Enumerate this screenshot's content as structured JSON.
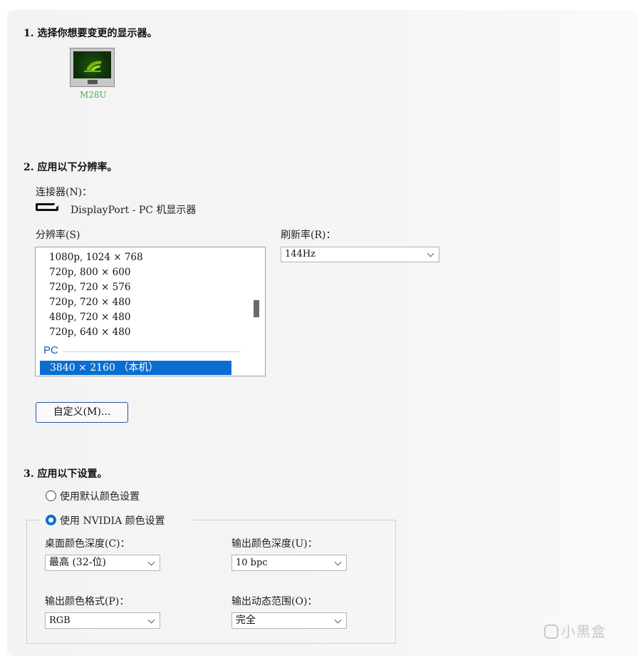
{
  "step1": {
    "title": "1. 选择你想要变更的显示器。",
    "monitor_name": "M28U"
  },
  "step2": {
    "title": "2. 应用以下分辨率。",
    "connector_label": "连接器(N)：",
    "connector_value": "DisplayPort - PC 机显示器",
    "resolution_label": "分辨率(S)",
    "refresh_label": "刷新率(R)：",
    "refresh_value": "144Hz",
    "resolutions": [
      "1080p, 1024 × 768",
      "720p, 800 × 600",
      "720p, 720 × 576",
      "720p, 720 × 480",
      "480p, 720 × 480",
      "720p, 640 × 480"
    ],
    "group_pc": "PC",
    "selected_resolution": "3840 × 2160 （本机）",
    "custom_button": "自定义(M)..."
  },
  "step3": {
    "title": "3. 应用以下设置。",
    "radio_default": "使用默认颜色设置",
    "radio_nvidia": "使用 NVIDIA 颜色设置",
    "desktop_depth_label": "桌面颜色深度(C)：",
    "desktop_depth_value": "最高 (32-位)",
    "output_depth_label": "输出颜色深度(U)：",
    "output_depth_value": "10 bpc",
    "output_format_label": "输出颜色格式(P)：",
    "output_format_value": "RGB",
    "dynamic_range_label": "输出动态范围(O)：",
    "dynamic_range_value": "完全"
  },
  "watermark": "小黑盒"
}
